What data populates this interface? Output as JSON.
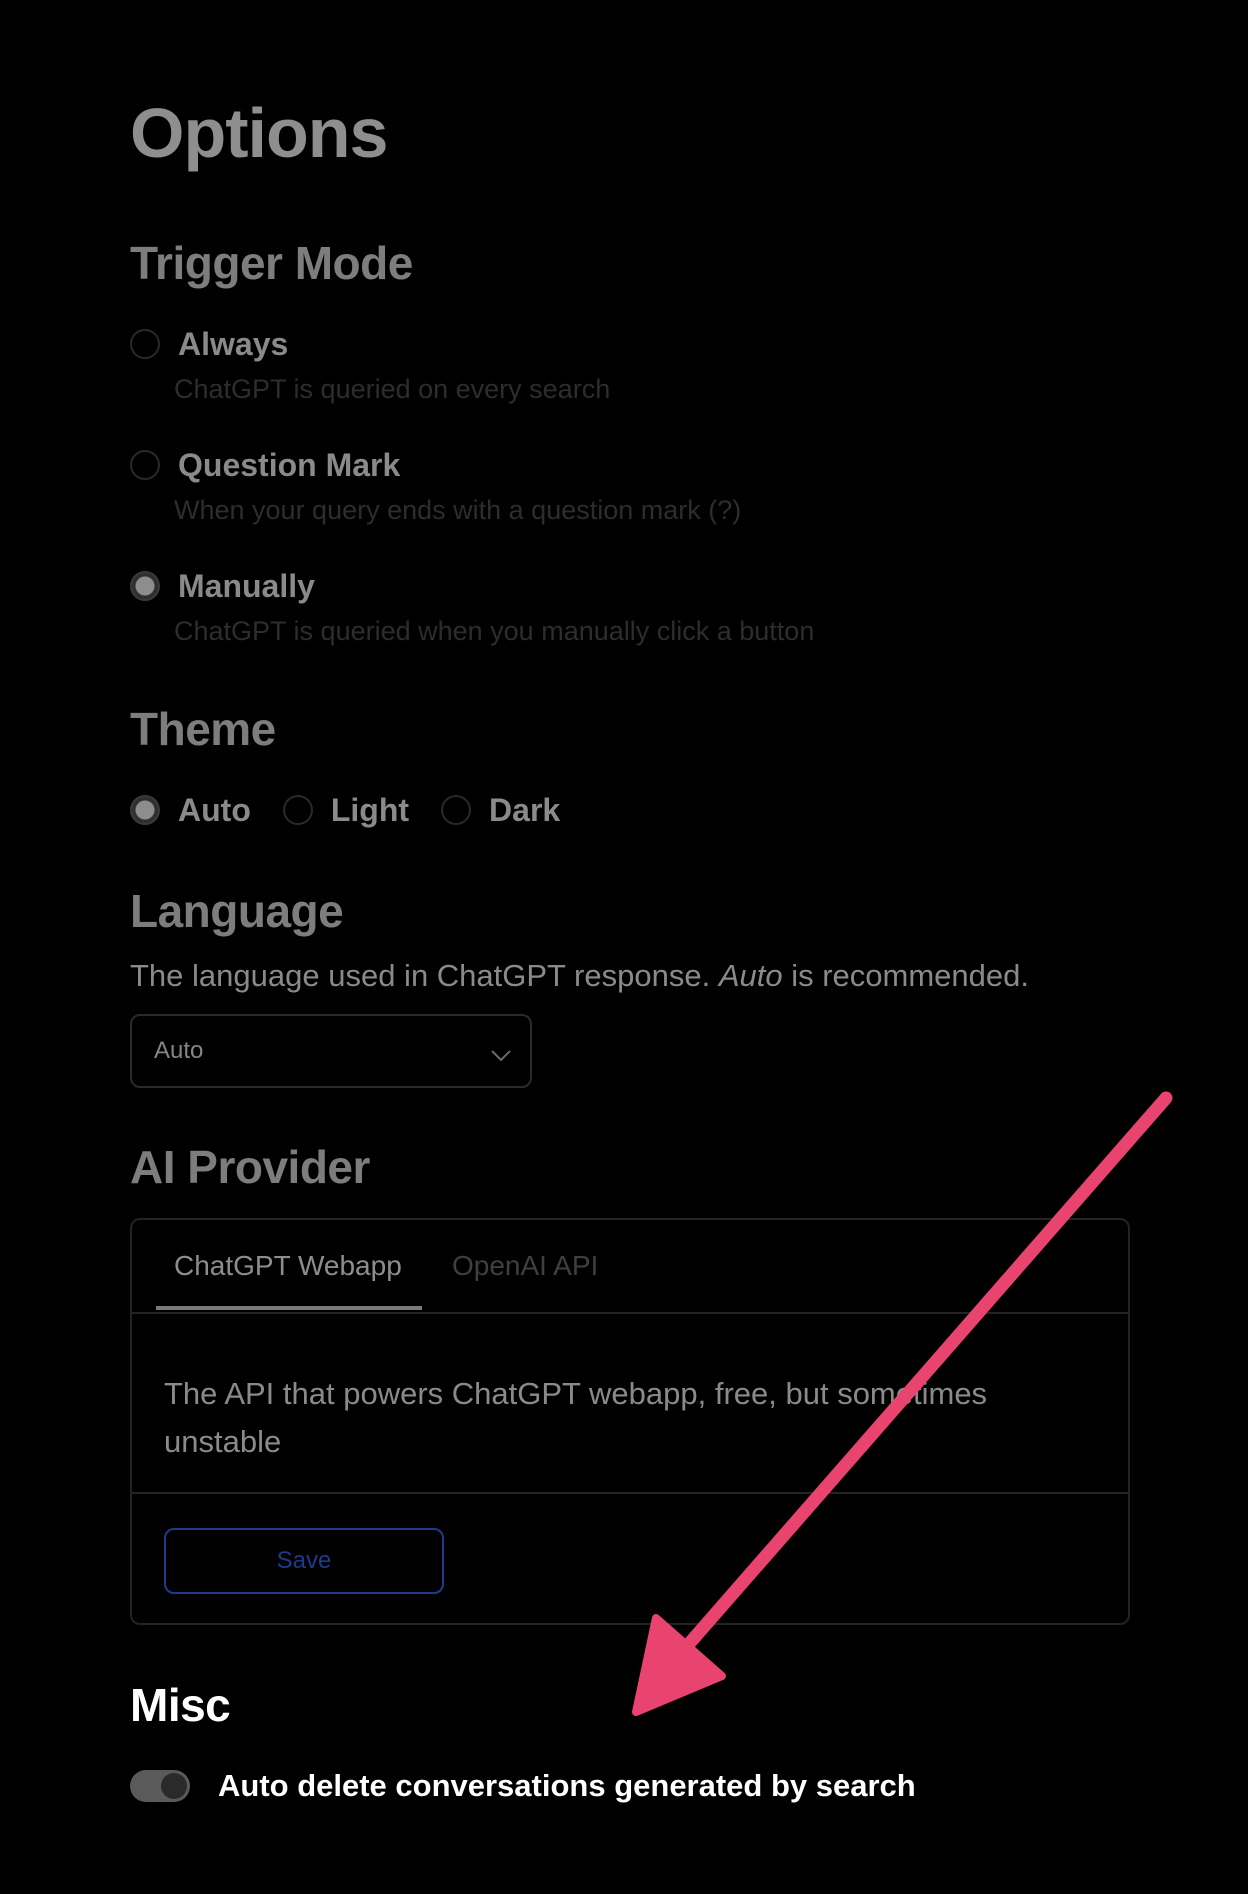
{
  "page": {
    "title": "Options"
  },
  "trigger_mode": {
    "title": "Trigger Mode",
    "options": [
      {
        "label": "Always",
        "description": "ChatGPT is queried on every search",
        "checked": false
      },
      {
        "label": "Question Mark",
        "description": "When your query ends with a question mark (?)",
        "checked": false
      },
      {
        "label": "Manually",
        "description": "ChatGPT is queried when you manually click a button",
        "checked": true
      }
    ]
  },
  "theme": {
    "title": "Theme",
    "options": [
      {
        "label": "Auto",
        "checked": true
      },
      {
        "label": "Light",
        "checked": false
      },
      {
        "label": "Dark",
        "checked": false
      }
    ]
  },
  "language": {
    "title": "Language",
    "description_before": "The language used in ChatGPT response. ",
    "description_emphasis": "Auto",
    "description_after": " is recommended.",
    "selected": "Auto"
  },
  "ai_provider": {
    "title": "AI Provider",
    "tabs": [
      {
        "label": "ChatGPT Webapp",
        "active": true
      },
      {
        "label": "OpenAI API",
        "active": false
      }
    ],
    "description": "The API that powers ChatGPT webapp, free, but sometimes unstable",
    "save_label": "Save"
  },
  "misc": {
    "title": "Misc",
    "toggle_label": "Auto delete conversations generated by search",
    "toggle_on": true
  },
  "colors": {
    "background": "#000000",
    "annotation_arrow": "#e8446f",
    "save_button": "#1e3a8a"
  },
  "icons": {
    "select_chevron": "chevron-down-icon",
    "annotation": "annotation-arrow-icon"
  }
}
